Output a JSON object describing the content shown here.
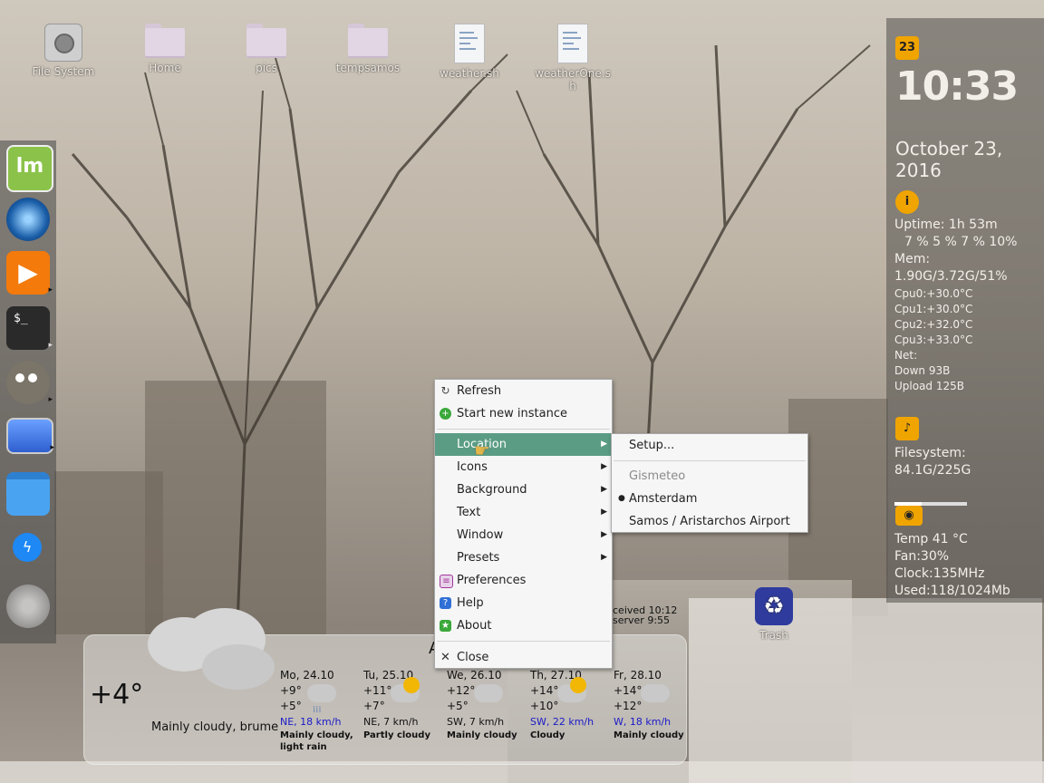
{
  "desktop_icons": [
    {
      "label": "File System",
      "icon": "hard-disk-icon"
    },
    {
      "label": "Home",
      "icon": "home-folder-icon"
    },
    {
      "label": "pics",
      "icon": "folder-icon"
    },
    {
      "label": "tempsamos",
      "icon": "folder-icon"
    },
    {
      "label": "weather.sh",
      "icon": "script-file-icon"
    },
    {
      "label": "weatherOne.sh",
      "icon": "script-file-icon"
    }
  ],
  "trash": {
    "label": "Trash"
  },
  "dock": [
    {
      "name": "mint-menu-icon"
    },
    {
      "name": "thunderbird-icon"
    },
    {
      "name": "media-player-icon"
    },
    {
      "name": "terminal-icon"
    },
    {
      "name": "gimp-icon"
    },
    {
      "name": "display-icon"
    },
    {
      "name": "files-icon"
    },
    {
      "name": "messenger-icon"
    },
    {
      "name": "weather-icon"
    }
  ],
  "conky": {
    "day": "23",
    "time": "10:33",
    "date": "October 23, 2016",
    "uptime": "Uptime: 1h 53m",
    "cpu_usage": "7 % 5 % 7 % 10%",
    "mem_label": "Mem:",
    "mem_value": "1.90G/3.72G/51%",
    "cpu0": "Cpu0:+30.0°C",
    "cpu1": "Cpu1:+30.0°C",
    "cpu2": "Cpu2:+32.0°C",
    "cpu3": "Cpu3:+33.0°C",
    "net": "Net:",
    "down": "Down 93B",
    "upload": "Upload 125B",
    "fs_label": "Filesystem:",
    "fs_value": "84.1G/225G",
    "fs_fraction": 0.37,
    "gpu_temp": "Temp 41 °C",
    "gpu_fan": "Fan:30%",
    "gpu_clock": "Clock:135MHz",
    "gpu_used": "Used:118/1024Mb"
  },
  "context_menu": {
    "items": [
      {
        "label": "Refresh",
        "icon": "refresh-icon"
      },
      {
        "label": "Start new instance",
        "icon": "plus-circle-icon"
      },
      {
        "label": "Location",
        "submenu": true
      },
      {
        "label": "Icons",
        "submenu": true
      },
      {
        "label": "Background",
        "submenu": true
      },
      {
        "label": "Text",
        "submenu": true
      },
      {
        "label": "Window",
        "submenu": true
      },
      {
        "label": "Presets",
        "submenu": true
      },
      {
        "label": "Preferences",
        "icon": "preferences-icon"
      },
      {
        "label": "Help",
        "icon": "help-icon"
      },
      {
        "label": "About",
        "icon": "about-star-icon"
      },
      {
        "label": "Close",
        "icon": "close-icon"
      }
    ]
  },
  "location_submenu": {
    "setup": "Setup...",
    "provider": "Gismeteo",
    "locations": [
      "Amsterdam",
      "Samos / Aristarchos Airport"
    ],
    "selected": "Amsterdam"
  },
  "weather": {
    "behind_text_1": "ceived 10:12",
    "behind_text_2": "server 9:55",
    "title_partial": "A",
    "current_temp": "+4°",
    "current_desc": "Mainly cloudy, brume",
    "days": [
      {
        "day": "Mo, 24.10",
        "hi": "+9°",
        "lo": "+5°",
        "wind": "NE, 18 km/h",
        "wind_color": "#1a1ac8",
        "desc": [
          "Mainly cloudy,",
          "light rain"
        ],
        "icon": "rain-cloud-icon"
      },
      {
        "day": "Tu, 25.10",
        "hi": "+11°",
        "lo": "+7°",
        "wind": "NE, 7 km/h",
        "wind_color": "#111111",
        "desc": [
          "Partly cloudy"
        ],
        "icon": "partly-cloudy-icon"
      },
      {
        "day": "We, 26.10",
        "hi": "+12°",
        "lo": "+5°",
        "wind": "SW, 7 km/h",
        "wind_color": "#111111",
        "desc": [
          "Mainly cloudy"
        ],
        "icon": "cloudy-icon"
      },
      {
        "day": "Th, 27.10",
        "hi": "+14°",
        "lo": "+10°",
        "wind": "SW, 22 km/h",
        "wind_color": "#1a1ac8",
        "desc": [
          "Cloudy"
        ],
        "icon": "partly-cloudy-icon"
      },
      {
        "day": "Fr, 28.10",
        "hi": "+14°",
        "lo": "+12°",
        "wind": "W, 18 km/h",
        "wind_color": "#1a1ac8",
        "desc": [
          "Mainly cloudy"
        ],
        "icon": "cloudy-icon"
      }
    ]
  },
  "colors": {
    "menu_highlight": "#5b9c85",
    "conky_accent": "#f0a400"
  }
}
